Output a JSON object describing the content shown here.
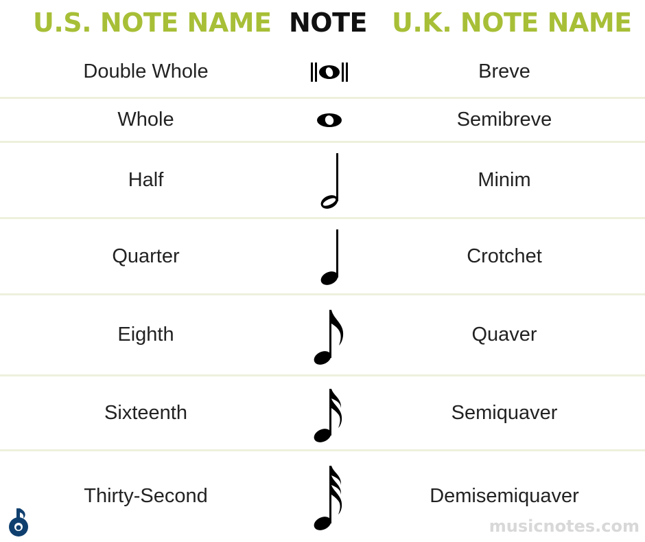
{
  "header": {
    "us_label": "U.S. NOTE NAME",
    "note_label": "NOTE",
    "uk_label": "U.K. NOTE NAME"
  },
  "rows": [
    {
      "us": "Double Whole",
      "uk": "Breve",
      "note_icon": "double-whole-note-icon"
    },
    {
      "us": "Whole",
      "uk": "Semibreve",
      "note_icon": "whole-note-icon"
    },
    {
      "us": "Half",
      "uk": "Minim",
      "note_icon": "half-note-icon"
    },
    {
      "us": "Quarter",
      "uk": "Crotchet",
      "note_icon": "quarter-note-icon"
    },
    {
      "us": "Eighth",
      "uk": "Quaver",
      "note_icon": "eighth-note-icon"
    },
    {
      "us": "Sixteenth",
      "uk": "Semiquaver",
      "note_icon": "sixteenth-note-icon"
    },
    {
      "us": "Thirty-Second",
      "uk": "Demisemiquaver",
      "note_icon": "thirty-second-note-icon"
    }
  ],
  "footer": {
    "brand": "musicnotes.com",
    "logo_icon": "musicnotes-logo-icon"
  },
  "colors": {
    "accent": "#a7bf37",
    "header_dark": "#111111",
    "divider": "#eef0dc",
    "brand_text": "#d8d8d8"
  }
}
